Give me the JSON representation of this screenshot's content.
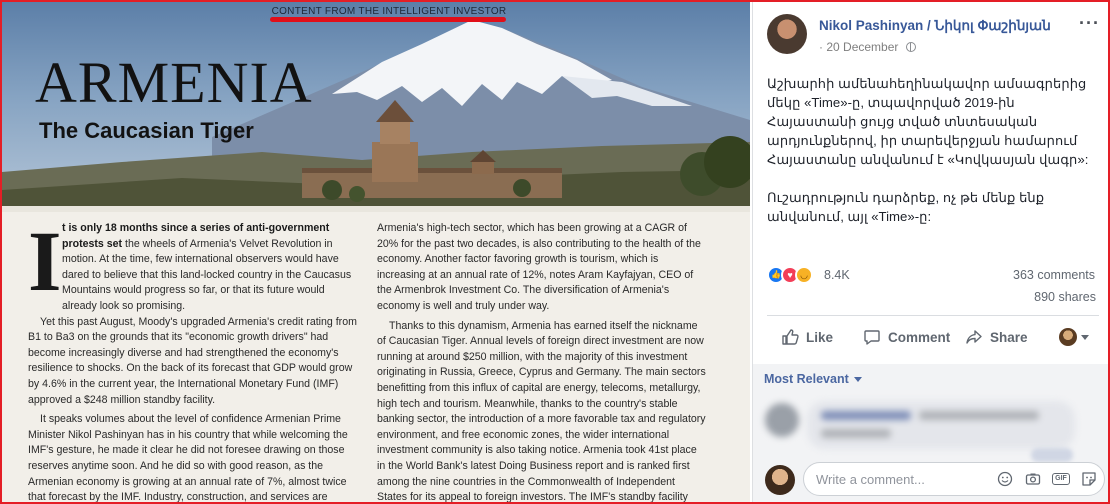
{
  "magazine": {
    "header": "CONTENT FROM THE INTELLIGENT INVESTOR",
    "headline": "ARMENIA",
    "subhead": "The Caucasian Tiger",
    "drop_cap": "I",
    "col1_lead_strong": "t is only 18 months since a series of anti-government protests set",
    "col1_lead_rest": "the wheels of Armenia's Velvet Revolution in motion. At the time, few international observers would have dared to believe that this land-locked country in the Caucasus Mountains would progress so far, or that its future would already look so promising.",
    "col1_p2": "Yet this past August, Moody's upgraded Armenia's credit rating from B1 to Ba3 on the grounds that its \"economic growth drivers\" had become increasingly diverse and had strengthened the economy's resilience to shocks. On the back of its forecast that GDP would grow by 4.6% in the current year, the International Monetary Fund (IMF) approved a $248 million standby facility.",
    "col1_p3": "It speaks volumes about the level of confidence Armenian Prime Minister Nikol Pashinyan has in his country that while welcoming the IMF's gesture, he made it clear he did not foresee drawing on those reserves anytime soon. And he did so with good reason, as the Armenian economy is growing at an annual rate of 7%, almost twice that forecast by the IMF. Industry, construction, and services are largely driving this economic expansion. But",
    "col2_p1": "Armenia's high-tech sector, which has been growing at a CAGR of 20% for the past two decades, is also contributing to the health of the economy. Another factor favoring growth is tourism, which is increasing at an annual rate of 12%, notes Aram Kayfajyan, CEO of the Armenbrok Investment Co. The diversification of Armenia's economy is well and truly under way.",
    "col2_p2": "Thanks to this dynamism, Armenia has earned itself the nickname of Caucasian Tiger. Annual levels of foreign direct investment are now running at around $250 million, with the majority of this investment originating in Russia, Greece, Cyprus and Germany. The main sectors benefitting from this influx of capital are energy, telecoms, metallurgy, high tech and tourism. Meanwhile, thanks to the country's stable banking sector, the introduction of a more favorable tax and regulatory environment, and free economic zones, the wider international investment community is also taking notice. Armenia took 41st place in the World Bank's latest Doing Business report and is ranked first among the nine countries in the Commonwealth of Independent States for its appeal to foreign investors. The IMF's standby facility may well and truly turn out to be superfluous."
  },
  "post": {
    "author": "Nikol Pashinyan / Նիկոլ Փաշինյան",
    "date": "20 December",
    "separator": "·",
    "body_p1": "Աշխարհի ամենահեղինակավոր ամսագրերից մեկը «Time»-ը, տպավորված 2019-ին Հայաստանի ցույց տված տնտեսական արդյունքներով, իր տարեվերջյան համարում Հայաստանը անվանում է «Կովկասյան վագր»:",
    "body_p2": "Ուշադրություն դարձրեք, ոչ թե մենք ենք անվանում, այլ «Time»-ը:",
    "reaction_count": "8.4K",
    "comments_count": "363 comments",
    "shares_count": "890 shares"
  },
  "actions": {
    "like": "Like",
    "comment": "Comment",
    "share": "Share"
  },
  "comments": {
    "sort_label": "Most Relevant",
    "placeholder": "Write a comment..."
  },
  "colors": {
    "frame_red": "#e41e26",
    "fb_blue": "#385898",
    "link_blue": "#4b67a1"
  }
}
